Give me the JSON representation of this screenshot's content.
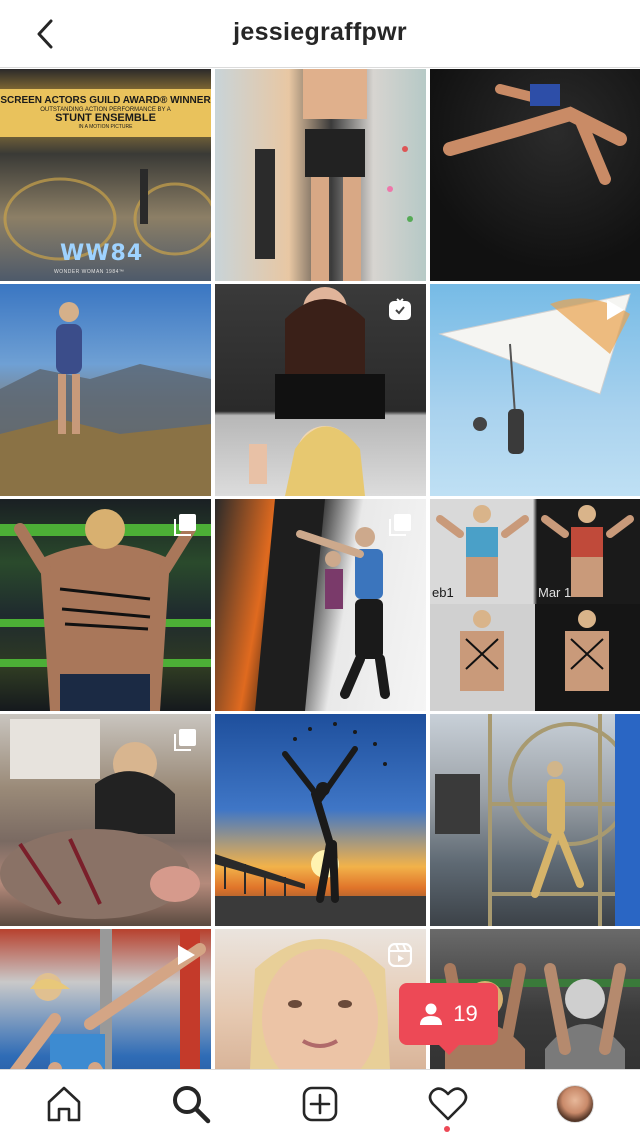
{
  "header": {
    "title": "jessiegraffpwr",
    "back_icon": "chevron-left-icon"
  },
  "posts": [
    {
      "kind": "image",
      "subject": "award-announcement",
      "banner_line1": "SCREEN ACTORS GUILD AWARD® WINNER",
      "banner_line2": "OUTSTANDING ACTION PERFORMANCE BY A",
      "banner_line3": "STUNT ENSEMBLE",
      "banner_line4": "IN A MOTION PICTURE",
      "logo_text": "WW84",
      "logo_sub": "WONDER WOMAN 1984™"
    },
    {
      "kind": "image",
      "subject": "gym-workout"
    },
    {
      "kind": "image",
      "subject": "leaping-athlete"
    },
    {
      "kind": "image",
      "subject": "mountain-hike"
    },
    {
      "kind": "igtv",
      "subject": "video-reaction",
      "badge_icon": "igtv-icon"
    },
    {
      "kind": "video",
      "subject": "hang-gliding",
      "badge_icon": "play-icon"
    },
    {
      "kind": "carousel",
      "subject": "back-workout",
      "badge_icon": "carousel-icon"
    },
    {
      "kind": "carousel",
      "subject": "wall-run",
      "badge_icon": "carousel-icon"
    },
    {
      "kind": "image",
      "subject": "progress-comparison",
      "label1": "eb1",
      "label2": "Mar 1"
    },
    {
      "kind": "carousel",
      "subject": "car-with-pig",
      "badge_icon": "carousel-icon"
    },
    {
      "kind": "image",
      "subject": "beach-jump"
    },
    {
      "kind": "image",
      "subject": "aerial-hoop"
    },
    {
      "kind": "video",
      "subject": "ninja-course",
      "badge_icon": "play-icon"
    },
    {
      "kind": "reels",
      "subject": "cookie-selfie",
      "badge_icon": "reels-icon"
    },
    {
      "kind": "image",
      "subject": "pullup-duo"
    }
  ],
  "notification": {
    "icon": "person-icon",
    "count": "19",
    "color": "#ed4956"
  },
  "navbar": {
    "items": [
      "home",
      "search",
      "add",
      "activity",
      "profile"
    ],
    "active": "search",
    "activity_dot": true,
    "accent": "#ed4956"
  }
}
